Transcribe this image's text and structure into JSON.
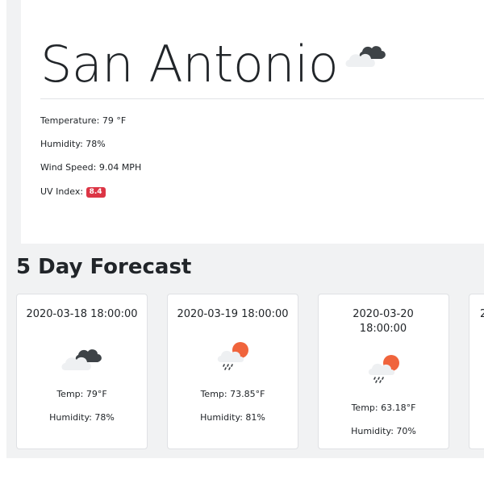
{
  "current": {
    "city": "San Antonio",
    "icon": "cloudy-icon",
    "temperature": "Temperature: 79 °F",
    "humidity": "Humidity: 78%",
    "wind_speed": "Wind Speed: 9.04 MPH",
    "uv_label": "UV Index:",
    "uv_value": "8.4",
    "uv_color": "#dc3545"
  },
  "forecast": {
    "heading": "5 Day Forecast",
    "days": [
      {
        "date": "2020-03-18 18:00:00",
        "icon": "cloudy-icon",
        "temp": "Temp: 79°F",
        "humidity": "Humidity: 78%"
      },
      {
        "date": "2020-03-19 18:00:00",
        "icon": "sun-rain-icon",
        "temp": "Temp: 73.85°F",
        "humidity": "Humidity: 81%"
      },
      {
        "date": "2020-03-20 18:00:00",
        "icon": "sun-rain-icon",
        "temp": "Temp: 63.18°F",
        "humidity": "Humidity: 70%"
      },
      {
        "date": "2",
        "icon": "",
        "temp": "",
        "humidity": ""
      }
    ]
  },
  "colors": {
    "page_background": "#f1f2f3",
    "sun": "#f0643c",
    "dark_cloud": "#3e4347",
    "light_cloud": "#eef0f2"
  }
}
